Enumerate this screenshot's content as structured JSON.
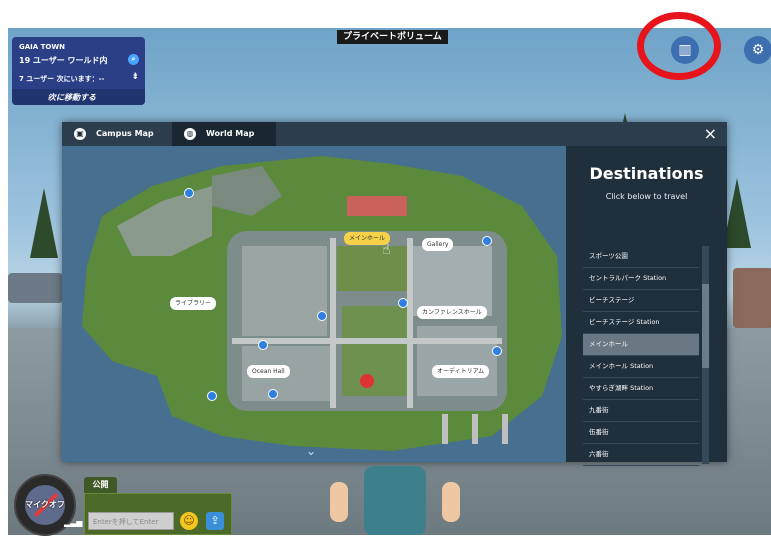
{
  "top_label": "プライベートボリューム",
  "info_panel": {
    "world_name": "GAIA TOWN",
    "users_line": "19 ユーザー ワールド内",
    "here_line": "7 ユーザー 次にいます：--",
    "next_label": "次に移動する"
  },
  "dialog": {
    "tabs": [
      {
        "label": "Campus Map",
        "icon": "campus-icon"
      },
      {
        "label": "World Map",
        "icon": "globe-icon"
      }
    ],
    "active_tab": "World Map",
    "close_label": "×",
    "map_labels": {
      "main_hall": "メインホール",
      "gallery": "Gallery",
      "library": "ライブラリー",
      "ocean_hall": "Ocean Hall",
      "conference": "カンファレンスホール",
      "art_center": "オーディトリアム"
    },
    "destinations": {
      "title": "Destinations",
      "subtitle": "Click below to travel",
      "items": [
        "スポーツ公園",
        "セントラルパーク Station",
        "ビーチステージ",
        "ビーチステージ Station",
        "メインホール",
        "メインホール Station",
        "やすらぎ湖畔 Station",
        "九番街",
        "伍番街",
        "六番街"
      ],
      "selected": "メインホール"
    }
  },
  "mic": {
    "label": "マイクオフ"
  },
  "chat": {
    "tab_label": "公開",
    "input_placeholder": "Enterを押してEnter"
  },
  "colors": {
    "highlight_ring": "#e8141b",
    "panel_blue": "#2a3f86",
    "dialog_bg": "#1c2a36",
    "selected_item": "#6a7883"
  }
}
